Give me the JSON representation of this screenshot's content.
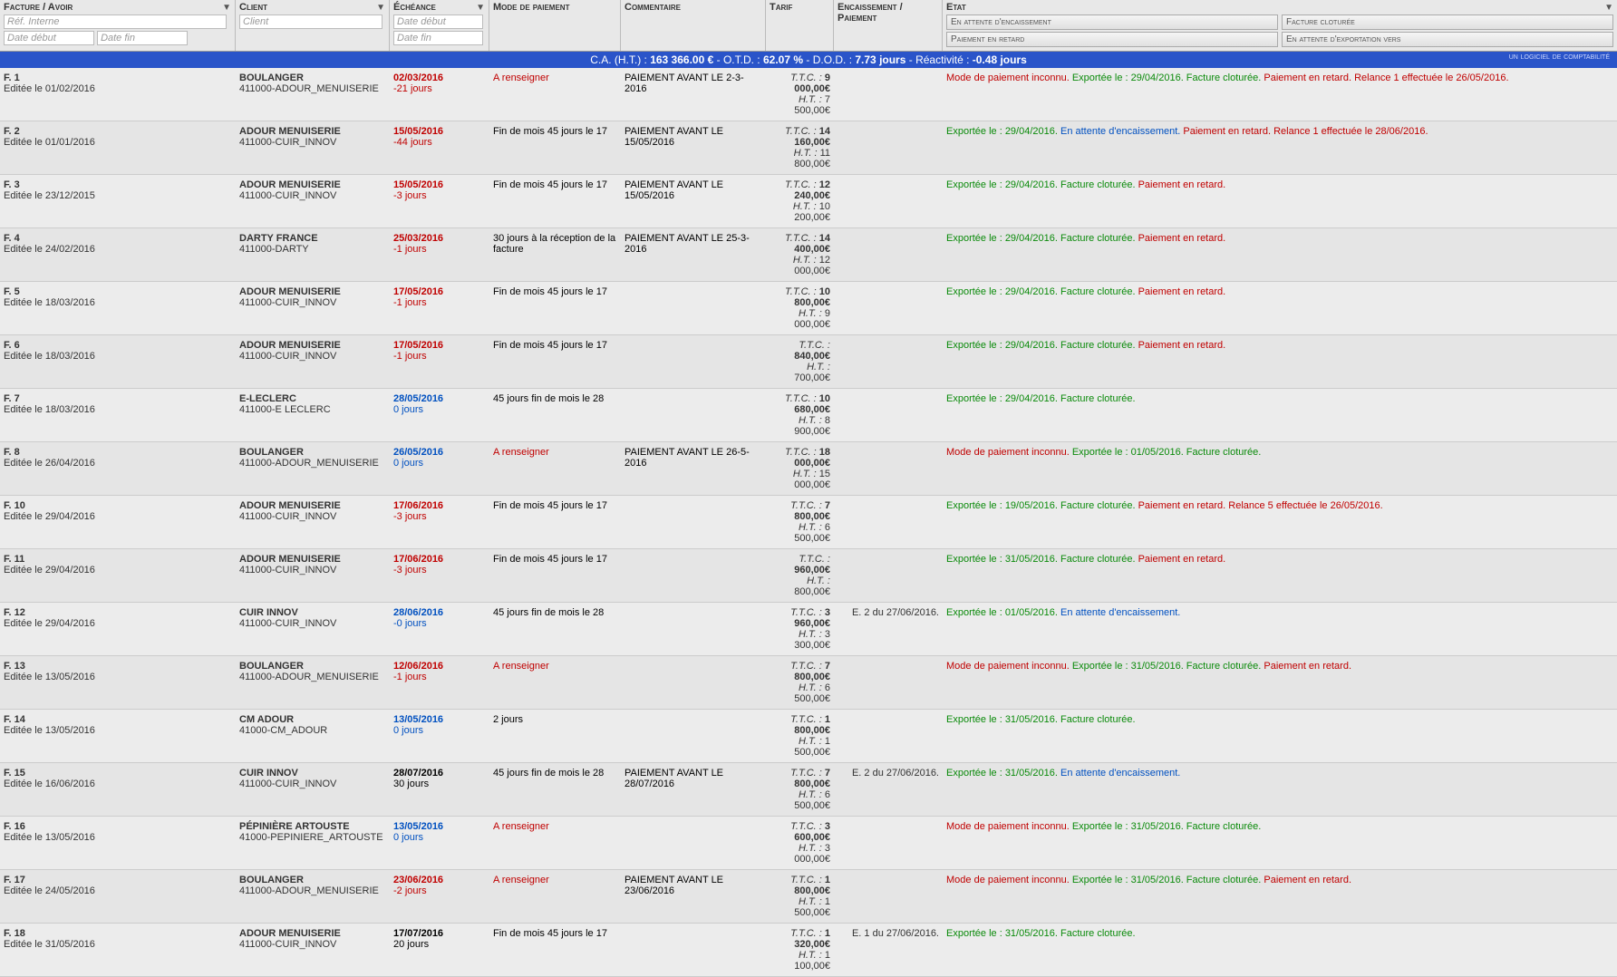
{
  "header": {
    "facture_avoir": "Facture / Avoir",
    "client": "Client",
    "echeance": "Échéance",
    "mode_paiement": "Mode de paiement",
    "commentaire": "Commentaire",
    "tarif": "Tarif",
    "encaissement": "Encaissement / Paiement",
    "etat": "Etat",
    "ph_ref": "Réf. Interne",
    "ph_date_debut": "Date début",
    "ph_date_fin": "Date fin",
    "ph_client": "Client",
    "state_btns": {
      "a": "En attente d'encaissement",
      "b": "Facture cloturée",
      "c": "Paiement en retard",
      "d": "En attente d'exportation vers"
    },
    "compta": "un logiciel de comptabilité"
  },
  "summary": {
    "ca_label": "C.A. (H.T.) :",
    "ca_val": "163 366.00 €",
    "otd_label": "- O.T.D. :",
    "otd_val": "62.07 %",
    "dod_label": "- D.O.D. :",
    "dod_val": "7.73 jours",
    "react_label": "- Réactivité :",
    "react_val": "-0.48 jours"
  },
  "rows": [
    {
      "f": "F. 1",
      "edit": "Editée le 01/02/2016",
      "client": "BOULANGER",
      "code": "411000-ADOUR_MENUISERIE",
      "date": "02/03/2016",
      "dstyle": "red",
      "days": "-21 jours",
      "daystyle": "red",
      "mode": "A renseigner",
      "modestyle": "red",
      "comment": "PAIEMENT AVANT LE 2-3-2016",
      "ttc": "9 000,00€",
      "ht": "7 500,00€",
      "enc": "",
      "etat": [
        {
          "t": "Mode de paiement inconnu.",
          "c": "red"
        },
        {
          "t": " Exportée le : 29/04/2016.",
          "c": "green"
        },
        {
          "t": " Facture cloturée.",
          "c": "green"
        },
        {
          "t": " Paiement en retard.",
          "c": "red"
        },
        {
          "t": " Relance 1 effectuée le 26/05/2016.",
          "c": "red"
        }
      ]
    },
    {
      "f": "F. 2",
      "edit": "Editée le 01/01/2016",
      "client": "ADOUR MENUISERIE",
      "code": "411000-CUIR_INNOV",
      "date": "15/05/2016",
      "dstyle": "red",
      "days": "-44 jours",
      "daystyle": "red",
      "mode": "Fin de mois 45 jours le 17",
      "modestyle": "black",
      "comment": "PAIEMENT AVANT LE 15/05/2016",
      "ttc": "14 160,00€",
      "ht": "11 800,00€",
      "enc": "",
      "etat": [
        {
          "t": "Exportée le : 29/04/2016.",
          "c": "green"
        },
        {
          "t": " En attente d'encaissement.",
          "c": "blue"
        },
        {
          "t": " Paiement en retard.",
          "c": "red"
        },
        {
          "t": " Relance 1 effectuée le 28/06/2016.",
          "c": "red"
        }
      ]
    },
    {
      "f": "F. 3",
      "edit": "Editée le 23/12/2015",
      "client": "ADOUR MENUISERIE",
      "code": "411000-CUIR_INNOV",
      "date": "15/05/2016",
      "dstyle": "red",
      "days": "-3 jours",
      "daystyle": "red",
      "mode": "Fin de mois 45 jours le 17",
      "modestyle": "black",
      "comment": "PAIEMENT AVANT LE 15/05/2016",
      "ttc": "12 240,00€",
      "ht": "10 200,00€",
      "enc": "",
      "etat": [
        {
          "t": "Exportée le : 29/04/2016.",
          "c": "green"
        },
        {
          "t": " Facture cloturée.",
          "c": "green"
        },
        {
          "t": " Paiement en retard.",
          "c": "red"
        }
      ]
    },
    {
      "f": "F. 4",
      "edit": "Editée le 24/02/2016",
      "client": "DARTY FRANCE",
      "code": "411000-DARTY",
      "date": "25/03/2016",
      "dstyle": "red",
      "days": "-1 jours",
      "daystyle": "red",
      "mode": "30 jours à la réception de la facture",
      "modestyle": "black",
      "comment": "PAIEMENT AVANT LE 25-3-2016",
      "ttc": "14 400,00€",
      "ht": "12 000,00€",
      "enc": "",
      "etat": [
        {
          "t": "Exportée le : 29/04/2016.",
          "c": "green"
        },
        {
          "t": " Facture cloturée.",
          "c": "green"
        },
        {
          "t": " Paiement en retard.",
          "c": "red"
        }
      ]
    },
    {
      "f": "F. 5",
      "edit": "Editée le 18/03/2016",
      "client": "ADOUR MENUISERIE",
      "code": "411000-CUIR_INNOV",
      "date": "17/05/2016",
      "dstyle": "red",
      "days": "-1 jours",
      "daystyle": "red",
      "mode": "Fin de mois 45 jours le 17",
      "modestyle": "black",
      "comment": "",
      "ttc": "10 800,00€",
      "ht": "9 000,00€",
      "enc": "",
      "etat": [
        {
          "t": "Exportée le : 29/04/2016.",
          "c": "green"
        },
        {
          "t": " Facture cloturée.",
          "c": "green"
        },
        {
          "t": " Paiement en retard.",
          "c": "red"
        }
      ]
    },
    {
      "f": "F. 6",
      "edit": "Editée le 18/03/2016",
      "client": "ADOUR MENUISERIE",
      "code": "411000-CUIR_INNOV",
      "date": "17/05/2016",
      "dstyle": "red",
      "days": "-1 jours",
      "daystyle": "red",
      "mode": "Fin de mois 45 jours le 17",
      "modestyle": "black",
      "comment": "",
      "ttc": "840,00€",
      "ht": "700,00€",
      "enc": "",
      "etat": [
        {
          "t": "Exportée le : 29/04/2016.",
          "c": "green"
        },
        {
          "t": " Facture cloturée.",
          "c": "green"
        },
        {
          "t": " Paiement en retard.",
          "c": "red"
        }
      ]
    },
    {
      "f": "F. 7",
      "edit": "Editée le 18/03/2016",
      "client": "E-LECLERC",
      "code": "411000-E LECLERC",
      "date": "28/05/2016",
      "dstyle": "blue",
      "days": "0 jours",
      "daystyle": "blue",
      "mode": "45 jours fin de mois le 28",
      "modestyle": "black",
      "comment": "",
      "ttc": "10 680,00€",
      "ht": "8 900,00€",
      "enc": "",
      "etat": [
        {
          "t": "Exportée le : 29/04/2016.",
          "c": "green"
        },
        {
          "t": " Facture cloturée.",
          "c": "green"
        }
      ]
    },
    {
      "f": "F. 8",
      "edit": "Editée le 26/04/2016",
      "client": "BOULANGER",
      "code": "411000-ADOUR_MENUISERIE",
      "date": "26/05/2016",
      "dstyle": "blue",
      "days": "0 jours",
      "daystyle": "blue",
      "mode": "A renseigner",
      "modestyle": "red",
      "comment": "PAIEMENT AVANT LE 26-5-2016",
      "ttc": "18 000,00€",
      "ht": "15 000,00€",
      "enc": "",
      "etat": [
        {
          "t": "Mode de paiement inconnu.",
          "c": "red"
        },
        {
          "t": " Exportée le : 01/05/2016.",
          "c": "green"
        },
        {
          "t": " Facture cloturée.",
          "c": "green"
        }
      ]
    },
    {
      "f": "F. 10",
      "edit": "Editée le 29/04/2016",
      "client": "ADOUR MENUISERIE",
      "code": "411000-CUIR_INNOV",
      "date": "17/06/2016",
      "dstyle": "red",
      "days": "-3 jours",
      "daystyle": "red",
      "mode": "Fin de mois 45 jours le 17",
      "modestyle": "black",
      "comment": "",
      "ttc": "7 800,00€",
      "ht": "6 500,00€",
      "enc": "",
      "etat": [
        {
          "t": "Exportée le : 19/05/2016.",
          "c": "green"
        },
        {
          "t": " Facture cloturée.",
          "c": "green"
        },
        {
          "t": " Paiement en retard.",
          "c": "red"
        },
        {
          "t": " Relance 5 effectuée le 26/05/2016.",
          "c": "red"
        }
      ]
    },
    {
      "f": "F. 11",
      "edit": "Editée le 29/04/2016",
      "client": "ADOUR MENUISERIE",
      "code": "411000-CUIR_INNOV",
      "date": "17/06/2016",
      "dstyle": "red",
      "days": "-3 jours",
      "daystyle": "red",
      "mode": "Fin de mois 45 jours le 17",
      "modestyle": "black",
      "comment": "",
      "ttc": "960,00€",
      "ht": "800,00€",
      "enc": "",
      "etat": [
        {
          "t": "Exportée le : 31/05/2016.",
          "c": "green"
        },
        {
          "t": " Facture cloturée.",
          "c": "green"
        },
        {
          "t": " Paiement en retard.",
          "c": "red"
        }
      ]
    },
    {
      "f": "F. 12",
      "edit": "Editée le 29/04/2016",
      "client": "CUIR INNOV",
      "code": "411000-CUIR_INNOV",
      "date": "28/06/2016",
      "dstyle": "blue",
      "days": "-0 jours",
      "daystyle": "blue",
      "mode": "45 jours fin de mois le 28",
      "modestyle": "black",
      "comment": "",
      "ttc": "3 960,00€",
      "ht": "3 300,00€",
      "enc": "E. 2 du 27/06/2016.",
      "etat": [
        {
          "t": "Exportée le : 01/05/2016.",
          "c": "green"
        },
        {
          "t": " En attente d'encaissement.",
          "c": "blue"
        }
      ]
    },
    {
      "f": "F. 13",
      "edit": "Editée le 13/05/2016",
      "client": "BOULANGER",
      "code": "411000-ADOUR_MENUISERIE",
      "date": "12/06/2016",
      "dstyle": "red",
      "days": "-1 jours",
      "daystyle": "red",
      "mode": "A renseigner",
      "modestyle": "red",
      "comment": "",
      "ttc": "7 800,00€",
      "ht": "6 500,00€",
      "enc": "",
      "etat": [
        {
          "t": "Mode de paiement inconnu.",
          "c": "red"
        },
        {
          "t": " Exportée le : 31/05/2016.",
          "c": "green"
        },
        {
          "t": " Facture cloturée.",
          "c": "green"
        },
        {
          "t": " Paiement en retard.",
          "c": "red"
        }
      ]
    },
    {
      "f": "F. 14",
      "edit": "Editée le 13/05/2016",
      "client": "CM ADOUR",
      "code": "41000-CM_ADOUR",
      "date": "13/05/2016",
      "dstyle": "blue",
      "days": "0 jours",
      "daystyle": "blue",
      "mode": "2 jours",
      "modestyle": "black",
      "comment": "",
      "ttc": "1 800,00€",
      "ht": "1 500,00€",
      "enc": "",
      "etat": [
        {
          "t": "Exportée le : 31/05/2016.",
          "c": "green"
        },
        {
          "t": " Facture cloturée.",
          "c": "green"
        }
      ]
    },
    {
      "f": "F. 15",
      "edit": "Editée le 16/06/2016",
      "client": "CUIR INNOV",
      "code": "411000-CUIR_INNOV",
      "date": "28/07/2016",
      "dstyle": "black",
      "days": "30 jours",
      "daystyle": "black",
      "mode": "45 jours fin de mois le 28",
      "modestyle": "black",
      "comment": "PAIEMENT AVANT LE 28/07/2016",
      "ttc": "7 800,00€",
      "ht": "6 500,00€",
      "enc": "E. 2 du 27/06/2016.",
      "etat": [
        {
          "t": "Exportée le : 31/05/2016.",
          "c": "green"
        },
        {
          "t": " En attente d'encaissement.",
          "c": "blue"
        }
      ]
    },
    {
      "f": "F. 16",
      "edit": "Editée le 13/05/2016",
      "client": "PéPINIèRE ARTOUSTE",
      "code": "41000-PEPINIERE_ARTOUSTE",
      "date": "13/05/2016",
      "dstyle": "blue",
      "days": "0 jours",
      "daystyle": "blue",
      "mode": "A renseigner",
      "modestyle": "red",
      "comment": "",
      "ttc": "3 600,00€",
      "ht": "3 000,00€",
      "enc": "",
      "etat": [
        {
          "t": "Mode de paiement inconnu.",
          "c": "red"
        },
        {
          "t": " Exportée le : 31/05/2016.",
          "c": "green"
        },
        {
          "t": " Facture cloturée.",
          "c": "green"
        }
      ]
    },
    {
      "f": "F. 17",
      "edit": "Editée le 24/05/2016",
      "client": "BOULANGER",
      "code": "411000-ADOUR_MENUISERIE",
      "date": "23/06/2016",
      "dstyle": "red",
      "days": "-2 jours",
      "daystyle": "red",
      "mode": "A renseigner",
      "modestyle": "red",
      "comment": "PAIEMENT AVANT LE 23/06/2016",
      "ttc": "1 800,00€",
      "ht": "1 500,00€",
      "enc": "",
      "etat": [
        {
          "t": "Mode de paiement inconnu.",
          "c": "red"
        },
        {
          "t": " Exportée le : 31/05/2016.",
          "c": "green"
        },
        {
          "t": " Facture cloturée.",
          "c": "green"
        },
        {
          "t": " Paiement en retard.",
          "c": "red"
        }
      ]
    },
    {
      "f": "F. 18",
      "edit": "Editée le 31/05/2016",
      "client": "ADOUR MENUISERIE",
      "code": "411000-CUIR_INNOV",
      "date": "17/07/2016",
      "dstyle": "black",
      "days": "20 jours",
      "daystyle": "black",
      "mode": "Fin de mois 45 jours le 17",
      "modestyle": "black",
      "comment": "",
      "ttc": "1 320,00€",
      "ht": "1 100,00€",
      "enc": "E. 1 du 27/06/2016.",
      "etat": [
        {
          "t": "Exportée le : 31/05/2016.",
          "c": "green"
        },
        {
          "t": " Facture cloturée.",
          "c": "green"
        }
      ]
    }
  ]
}
